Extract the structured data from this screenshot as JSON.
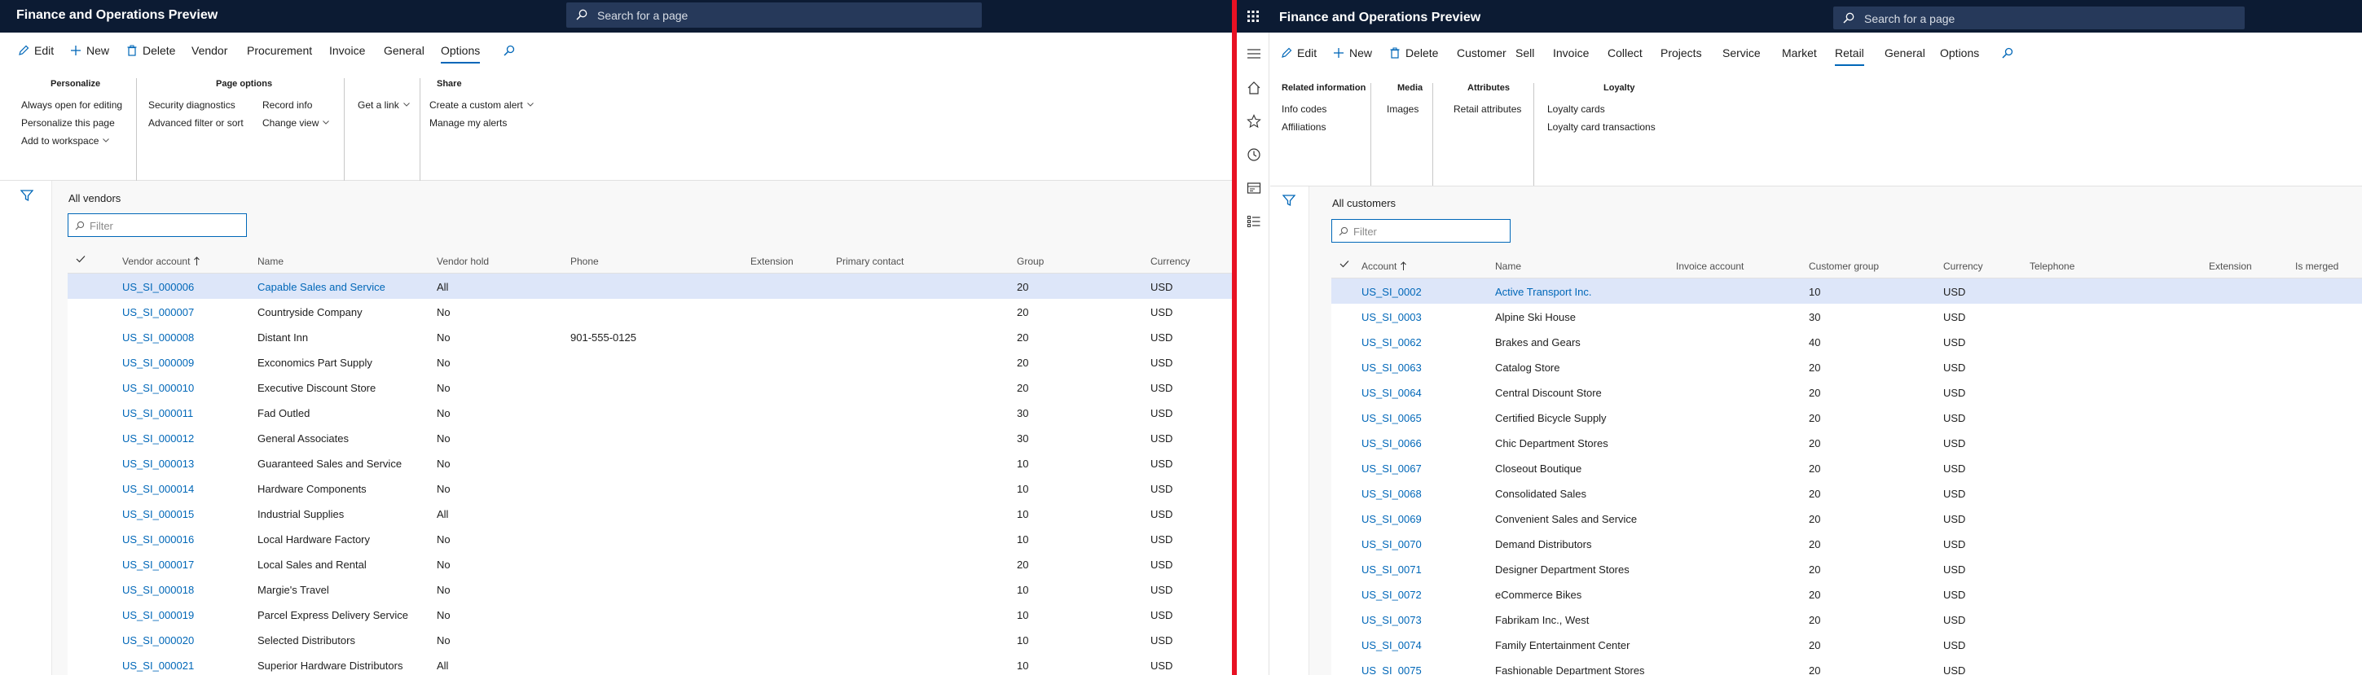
{
  "left": {
    "app_title": "Finance and Operations Preview",
    "search_placeholder": "Search for a page",
    "tabs": [
      {
        "label": "Edit"
      },
      {
        "label": "New"
      },
      {
        "label": "Delete"
      },
      {
        "label": "Vendor"
      },
      {
        "label": "Procurement"
      },
      {
        "label": "Invoice"
      },
      {
        "label": "General"
      },
      {
        "label": "Options"
      }
    ],
    "active_tab": "Options",
    "groups": {
      "personalize": {
        "title": "Personalize",
        "items": [
          "Always open for editing",
          "Personalize this page",
          "Add to workspace"
        ]
      },
      "page_options": {
        "title": "Page options",
        "col1": [
          "Security diagnostics",
          "Advanced filter or sort"
        ],
        "col2": [
          "Record info",
          "Change view"
        ]
      },
      "get_link": {
        "items": [
          "Get a link"
        ]
      },
      "share": {
        "title": "Share",
        "items": [
          "Create a custom alert",
          "Manage my alerts"
        ]
      }
    },
    "view_title": "All vendors",
    "filter_placeholder": "Filter",
    "columns": [
      "Vendor account",
      "Name",
      "Vendor hold",
      "Phone",
      "Extension",
      "Primary contact",
      "Group",
      "Currency"
    ],
    "rows": [
      {
        "account": "US_SI_000006",
        "name": "Capable Sales and Service",
        "hold": "All",
        "phone": "",
        "group": "20",
        "currency": "USD"
      },
      {
        "account": "US_SI_000007",
        "name": "Countryside Company",
        "hold": "No",
        "phone": "",
        "group": "20",
        "currency": "USD"
      },
      {
        "account": "US_SI_000008",
        "name": "Distant Inn",
        "hold": "No",
        "phone": "901-555-0125",
        "group": "20",
        "currency": "USD"
      },
      {
        "account": "US_SI_000009",
        "name": "Exconomics Part Supply",
        "hold": "No",
        "phone": "",
        "group": "20",
        "currency": "USD"
      },
      {
        "account": "US_SI_000010",
        "name": "Executive Discount Store",
        "hold": "No",
        "phone": "",
        "group": "20",
        "currency": "USD"
      },
      {
        "account": "US_SI_000011",
        "name": "Fad Outled",
        "hold": "No",
        "phone": "",
        "group": "30",
        "currency": "USD"
      },
      {
        "account": "US_SI_000012",
        "name": "General Associates",
        "hold": "No",
        "phone": "",
        "group": "30",
        "currency": "USD"
      },
      {
        "account": "US_SI_000013",
        "name": "Guaranteed Sales and Service",
        "hold": "No",
        "phone": "",
        "group": "10",
        "currency": "USD"
      },
      {
        "account": "US_SI_000014",
        "name": "Hardware Components",
        "hold": "No",
        "phone": "",
        "group": "10",
        "currency": "USD"
      },
      {
        "account": "US_SI_000015",
        "name": "Industrial Supplies",
        "hold": "All",
        "phone": "",
        "group": "10",
        "currency": "USD"
      },
      {
        "account": "US_SI_000016",
        "name": "Local Hardware Factory",
        "hold": "No",
        "phone": "",
        "group": "10",
        "currency": "USD"
      },
      {
        "account": "US_SI_000017",
        "name": "Local Sales and Rental",
        "hold": "No",
        "phone": "",
        "group": "20",
        "currency": "USD"
      },
      {
        "account": "US_SI_000018",
        "name": "Margie's Travel",
        "hold": "No",
        "phone": "",
        "group": "10",
        "currency": "USD"
      },
      {
        "account": "US_SI_000019",
        "name": "Parcel Express Delivery Service",
        "hold": "No",
        "phone": "",
        "group": "10",
        "currency": "USD"
      },
      {
        "account": "US_SI_000020",
        "name": "Selected Distributors",
        "hold": "No",
        "phone": "",
        "group": "10",
        "currency": "USD"
      },
      {
        "account": "US_SI_000021",
        "name": "Superior Hardware Distributors",
        "hold": "All",
        "phone": "",
        "group": "10",
        "currency": "USD"
      }
    ]
  },
  "right": {
    "app_title": "Finance and Operations Preview",
    "search_placeholder": "Search for a page",
    "tabs": [
      {
        "label": "Edit"
      },
      {
        "label": "New"
      },
      {
        "label": "Delete"
      },
      {
        "label": "Customer"
      },
      {
        "label": "Sell"
      },
      {
        "label": "Invoice"
      },
      {
        "label": "Collect"
      },
      {
        "label": "Projects"
      },
      {
        "label": "Service"
      },
      {
        "label": "Market"
      },
      {
        "label": "Retail"
      },
      {
        "label": "General"
      },
      {
        "label": "Options"
      }
    ],
    "active_tab": "Retail",
    "groups": {
      "related": {
        "title": "Related information",
        "items": [
          "Info codes",
          "Affiliations"
        ]
      },
      "media": {
        "title": "Media",
        "items": [
          "Images"
        ]
      },
      "attributes": {
        "title": "Attributes",
        "items": [
          "Retail attributes"
        ]
      },
      "loyalty": {
        "title": "Loyalty",
        "items": [
          "Loyalty cards",
          "Loyalty card transactions"
        ]
      }
    },
    "view_title": "All customers",
    "filter_placeholder": "Filter",
    "columns": [
      "Account",
      "Name",
      "Invoice account",
      "Customer group",
      "Currency",
      "Telephone",
      "Extension",
      "Is merged"
    ],
    "rows": [
      {
        "account": "US_SI_0002",
        "name": "Active Transport Inc.",
        "group": "10",
        "currency": "USD"
      },
      {
        "account": "US_SI_0003",
        "name": "Alpine Ski House",
        "group": "30",
        "currency": "USD"
      },
      {
        "account": "US_SI_0062",
        "name": "Brakes and Gears",
        "group": "40",
        "currency": "USD"
      },
      {
        "account": "US_SI_0063",
        "name": "Catalog Store",
        "group": "20",
        "currency": "USD"
      },
      {
        "account": "US_SI_0064",
        "name": "Central Discount Store",
        "group": "20",
        "currency": "USD"
      },
      {
        "account": "US_SI_0065",
        "name": "Certified Bicycle Supply",
        "group": "20",
        "currency": "USD"
      },
      {
        "account": "US_SI_0066",
        "name": "Chic Department Stores",
        "group": "20",
        "currency": "USD"
      },
      {
        "account": "US_SI_0067",
        "name": "Closeout Boutique",
        "group": "20",
        "currency": "USD"
      },
      {
        "account": "US_SI_0068",
        "name": "Consolidated Sales",
        "group": "20",
        "currency": "USD"
      },
      {
        "account": "US_SI_0069",
        "name": "Convenient Sales and Service",
        "group": "20",
        "currency": "USD"
      },
      {
        "account": "US_SI_0070",
        "name": "Demand Distributors",
        "group": "20",
        "currency": "USD"
      },
      {
        "account": "US_SI_0071",
        "name": "Designer Department Stores",
        "group": "20",
        "currency": "USD"
      },
      {
        "account": "US_SI_0072",
        "name": "eCommerce Bikes",
        "group": "20",
        "currency": "USD"
      },
      {
        "account": "US_SI_0073",
        "name": "Fabrikam Inc., West",
        "group": "20",
        "currency": "USD"
      },
      {
        "account": "US_SI_0074",
        "name": "Family Entertainment Center",
        "group": "20",
        "currency": "USD"
      },
      {
        "account": "US_SI_0075",
        "name": "Fashionable Department Stores",
        "group": "20",
        "currency": "USD"
      }
    ]
  },
  "colors": {
    "topbar": "#0c1b33",
    "accent": "#0067b8",
    "selected_row": "#dde6f9",
    "divider": "#e81123"
  }
}
